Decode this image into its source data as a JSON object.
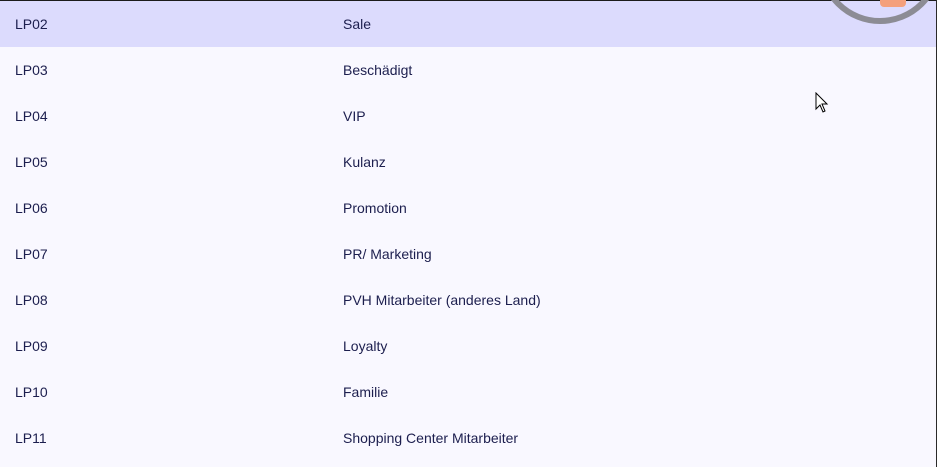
{
  "rows": [
    {
      "code": "LP02",
      "desc": "Sale",
      "selected": true
    },
    {
      "code": "LP03",
      "desc": "Beschädigt"
    },
    {
      "code": "LP04",
      "desc": "VIP"
    },
    {
      "code": "LP05",
      "desc": "Kulanz"
    },
    {
      "code": "LP06",
      "desc": "Promotion"
    },
    {
      "code": "LP07",
      "desc": "PR/ Marketing"
    },
    {
      "code": "LP08",
      "desc": "PVH Mitarbeiter (anderes Land)"
    },
    {
      "code": "LP09",
      "desc": "Loyalty"
    },
    {
      "code": "LP10",
      "desc": "Familie"
    },
    {
      "code": "LP11",
      "desc": "Shopping Center Mitarbeiter"
    }
  ],
  "colors": {
    "selected_row": "#dcdbfd",
    "row_background": "#f9f8ff",
    "text": "#1c1e4e",
    "loader_ring": "#8c8c94",
    "loader_accent": "#f4a07c"
  },
  "icons": {
    "loader": "loading-spinner-icon",
    "cursor": "mouse-pointer-icon"
  }
}
